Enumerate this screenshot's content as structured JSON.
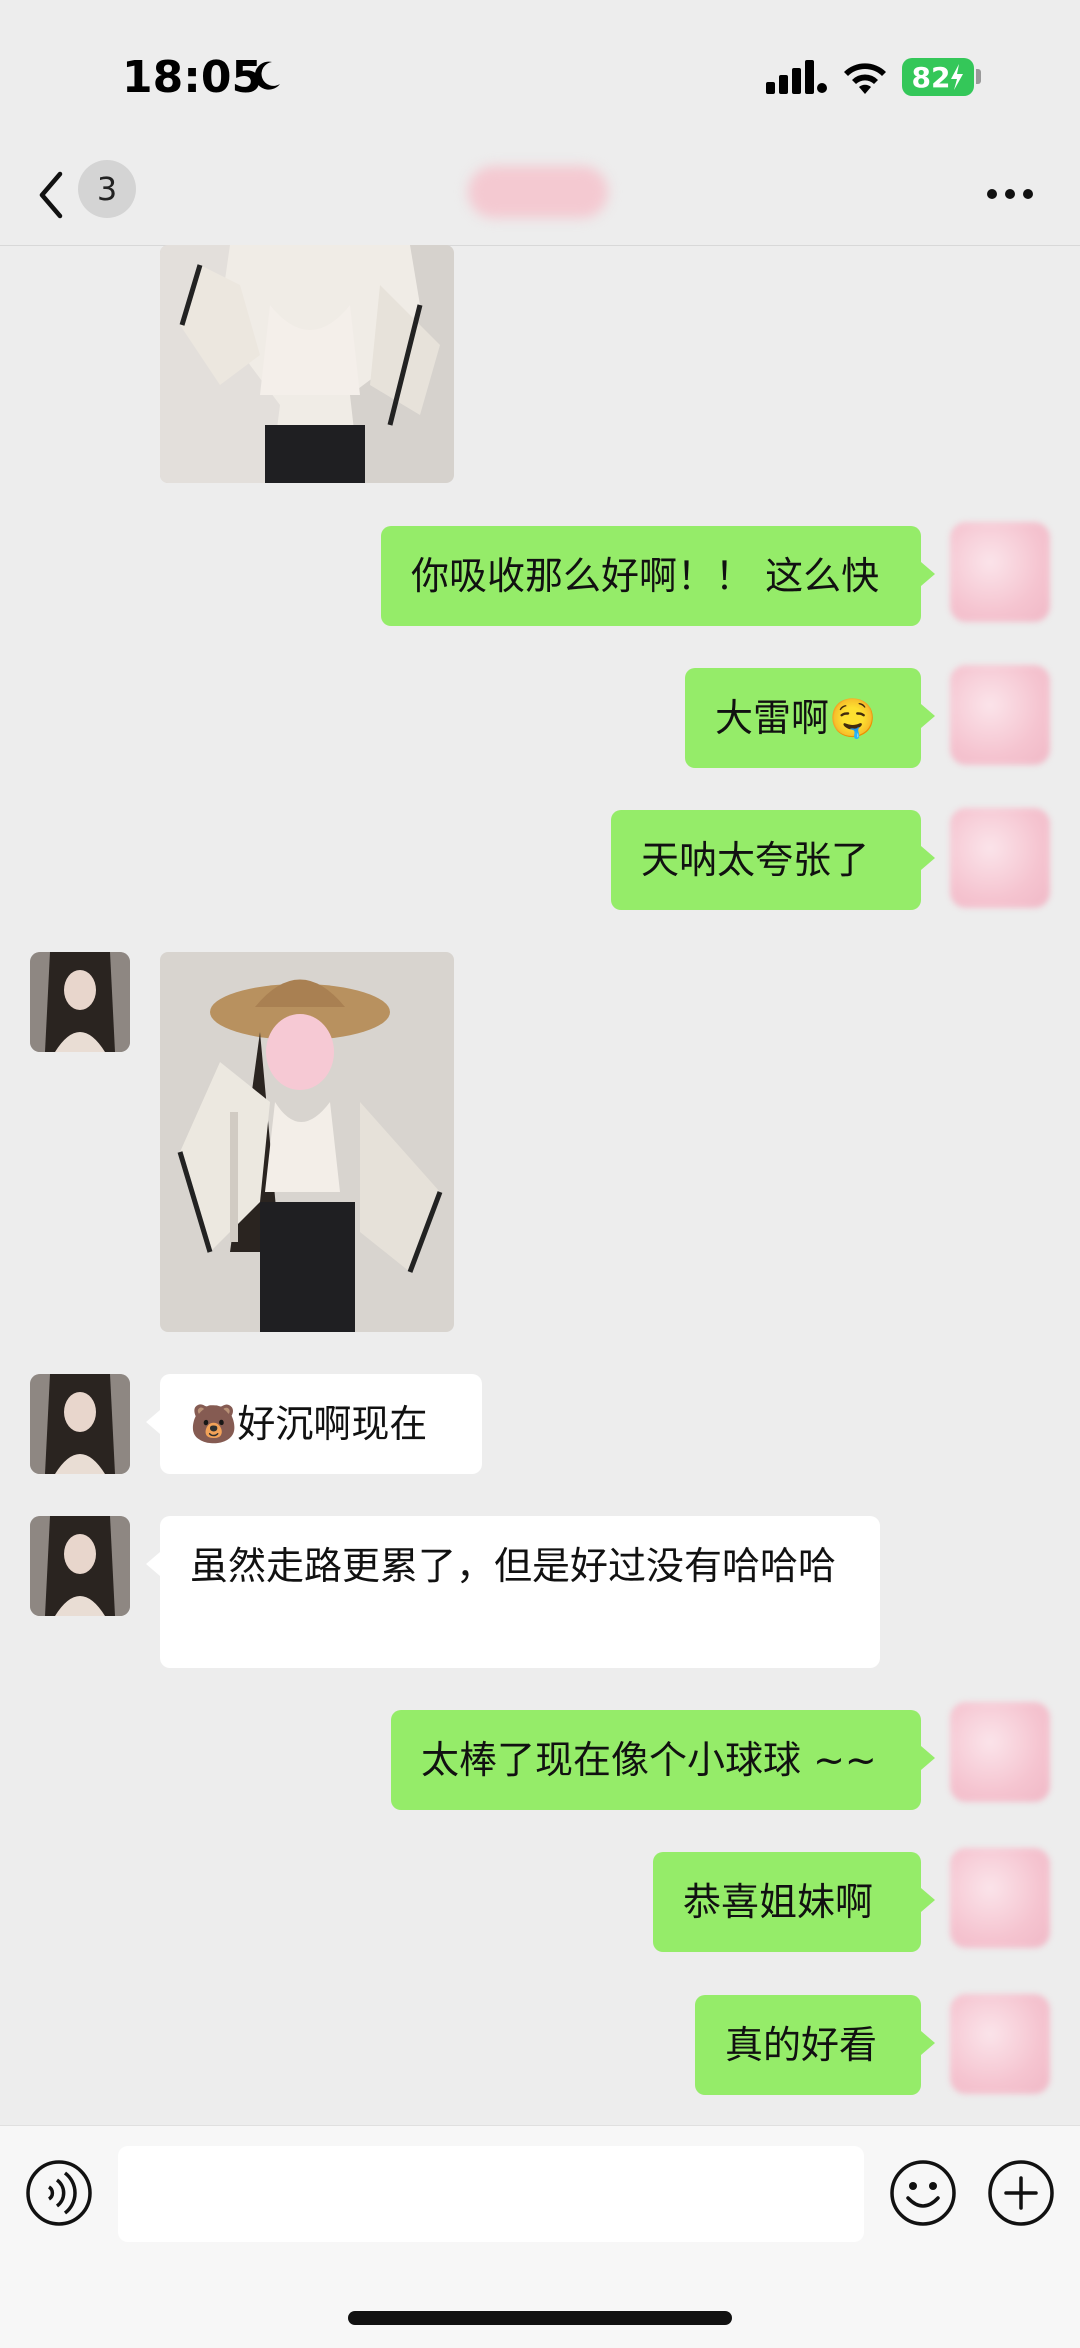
{
  "status": {
    "time": "18:05",
    "battery": "82"
  },
  "nav": {
    "unread_count": "3"
  },
  "messages": [
    {
      "text": "你吸收那么好啊！！ 这么快"
    },
    {
      "text": "大雷啊🤤"
    },
    {
      "text": "天呐太夸张了"
    },
    {
      "text": "🐻好沉啊现在"
    },
    {
      "text": "虽然走路更累了，但是好过没有哈哈哈"
    },
    {
      "text": "太棒了现在像个小球球 ~~"
    },
    {
      "text": "恭喜姐妹啊"
    },
    {
      "text": "真的好看"
    }
  ],
  "colors": {
    "outgoing_bubble": "#95ec69",
    "incoming_bubble": "#ffffff",
    "background": "#ededed"
  },
  "icons": [
    "moon-icon",
    "signal-icon",
    "wifi-icon",
    "back-icon",
    "more-icon",
    "voice-icon",
    "emoji-icon",
    "plus-icon"
  ]
}
